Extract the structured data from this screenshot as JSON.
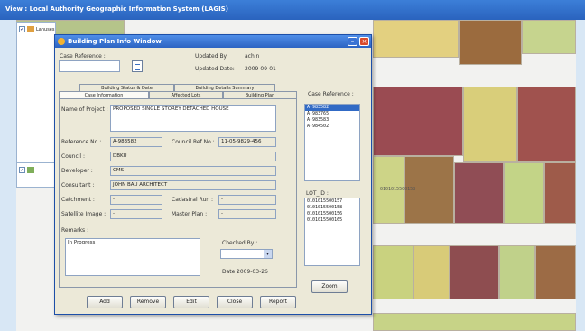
{
  "app": {
    "title": "View : Local Authority Geographic Information System (LAGIS)"
  },
  "layers": [
    {
      "label": "Lanuses",
      "checked": true
    },
    {
      "label": "",
      "checked": true
    }
  ],
  "map": {
    "parcel_label": "0101015500158"
  },
  "dialog": {
    "title": "Building Plan Info Window",
    "case_reference_label": "Case Reference :",
    "case_reference_value": "",
    "updated_by_label": "Updated By:",
    "updated_by_value": "achin",
    "updated_date_label": "Updated Date:",
    "updated_date_value": "2009-09-01",
    "tabs_row1": [
      "Building Status & Date",
      "Building Details Summary"
    ],
    "tabs_row2": [
      "Case Information",
      "Affected Lots",
      "Building Plan"
    ],
    "form": {
      "project_label": "Name of Project :",
      "project_value": "PROPOSED SINGLE STOREY DETACHED HOUSE",
      "reference_no_label": "Reference No :",
      "reference_no_value": "A-983582",
      "council_ref_label": "Council Ref No :",
      "council_ref_value": "11-05-9829-456",
      "council_label": "Council :",
      "council_value": "DBKU",
      "developer_label": "Developer :",
      "developer_value": "CMS",
      "consultant_label": "Consultant :",
      "consultant_value": "JOHN BAU ARCHITECT",
      "catchment_label": "Catchment :",
      "catchment_value": "-",
      "cadastral_label": "Cadastral Run :",
      "cadastral_value": "-",
      "satellite_label": "Satellite Image :",
      "satellite_value": "-",
      "master_plan_label": "Master Plan :",
      "master_plan_value": "-",
      "remarks_label": "Remarks :",
      "remarks_value": "In Progress",
      "checked_by_label": "Checked By :",
      "checked_by_value": "",
      "date_label": "Date :",
      "date_value": "2009-03-26"
    },
    "case_reference_list_label": "Case Reference :",
    "case_reference_list": [
      "A-983582",
      "A-983765",
      "A-983583",
      "A-984502"
    ],
    "lot_id_label": "LOT_ID :",
    "lot_id_list": [
      "0101015500157",
      "0101015500158",
      "0101015500156",
      "0101015500165"
    ],
    "buttons": {
      "zoom": "Zoom",
      "add": "Add",
      "remove": "Remove",
      "edit": "Edit",
      "close": "Close",
      "report": "Report"
    }
  }
}
